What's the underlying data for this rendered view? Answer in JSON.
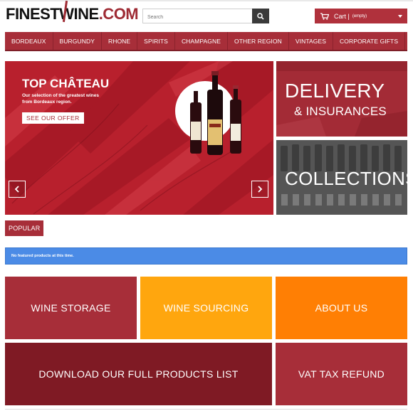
{
  "header": {
    "logo_part1": "FINEST",
    "logo_w": "W",
    "logo_part2": "INE",
    "logo_tld": ".COM",
    "search_placeholder": "Search",
    "cart_label": "Cart |",
    "cart_status": "(empty)"
  },
  "nav": {
    "items": [
      {
        "label": "BORDEAUX"
      },
      {
        "label": "BURGUNDY"
      },
      {
        "label": "RHONE"
      },
      {
        "label": "SPIRITS"
      },
      {
        "label": "CHAMPAGNE"
      },
      {
        "label": "OTHER REGION"
      },
      {
        "label": "VINTAGES"
      },
      {
        "label": "CORPORATE GIFTS"
      }
    ]
  },
  "slider": {
    "title": "TOP CHÂTEAU",
    "subtitle": "Our selection of the greatest wines from Bordeaux region.",
    "button": "SEE OUR OFFER"
  },
  "promos": {
    "delivery_line1": "DELIVERY",
    "delivery_line2": "& INSURANCES",
    "collections": "COLLECTIONS"
  },
  "popular": {
    "tab": "POPULAR",
    "notice": "No featured products at this time."
  },
  "tiles": {
    "storage": "WINE STORAGE",
    "sourcing": "WINE SOURCING",
    "about": "ABOUT US",
    "download": "DOWNLOAD OUR FULL PRODUCTS LIST",
    "vat": "VAT TAX REFUND"
  },
  "colors": {
    "brand": "#a72e39",
    "dark_red": "#7f1a24",
    "orange": "#ff7f04",
    "amber": "#ffa60e",
    "info_blue": "#4b8be6"
  }
}
